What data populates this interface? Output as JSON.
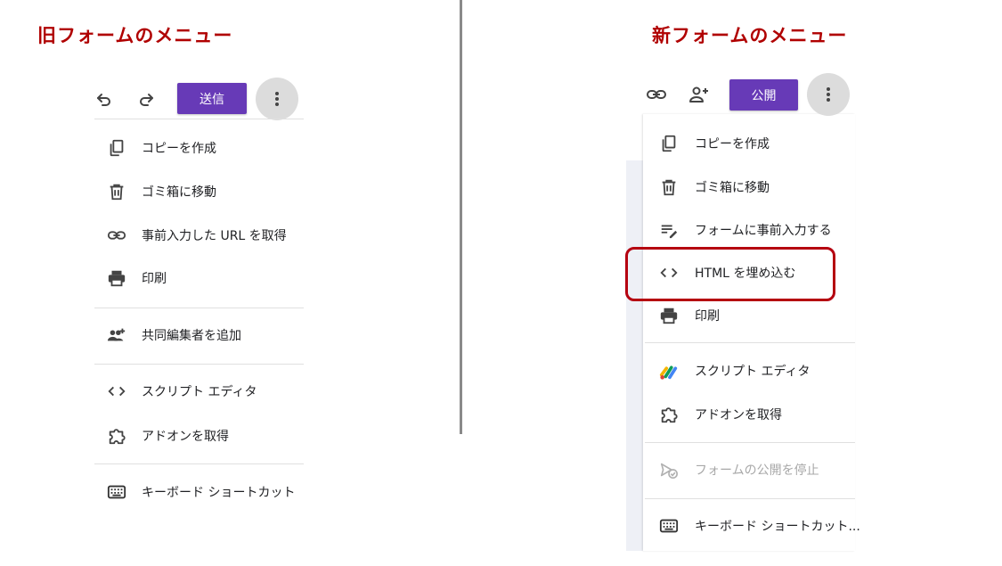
{
  "old_menu": {
    "heading": "旧フォームのメニュー",
    "toolbar": {
      "undo_icon": "undo-icon",
      "redo_icon": "redo-icon",
      "send_label": "送信",
      "more_icon": "more-vert-icon"
    },
    "items": [
      {
        "icon": "copy-icon",
        "label": "コピーを作成"
      },
      {
        "icon": "trash-icon",
        "label": "ゴミ箱に移動"
      },
      {
        "icon": "link-icon",
        "label": "事前入力した URL を取得"
      },
      {
        "icon": "print-icon",
        "label": "印刷"
      },
      {
        "icon": "collaborators-icon",
        "label": "共同編集者を追加"
      },
      {
        "icon": "code-icon",
        "label": "スクリプト エディタ"
      },
      {
        "icon": "puzzle-icon",
        "label": "アドオンを取得"
      },
      {
        "icon": "keyboard-icon",
        "label": "キーボード ショートカット"
      }
    ]
  },
  "new_menu": {
    "heading": "新フォームのメニュー",
    "toolbar": {
      "link_icon": "link-icon",
      "add_person_icon": "add-person-icon",
      "publish_label": "公開",
      "more_icon": "more-vert-icon"
    },
    "items": [
      {
        "icon": "copy-icon",
        "label": "コピーを作成"
      },
      {
        "icon": "trash-icon",
        "label": "ゴミ箱に移動"
      },
      {
        "icon": "prefill-icon",
        "label": "フォームに事前入力する"
      },
      {
        "icon": "code-icon",
        "label": "HTML を埋め込む"
      },
      {
        "icon": "print-icon",
        "label": "印刷"
      },
      {
        "icon": "apps-script-icon",
        "label": "スクリプト エディタ"
      },
      {
        "icon": "puzzle-icon",
        "label": "アドオンを取得"
      },
      {
        "icon": "unpublish-icon",
        "label": "フォームの公開を停止",
        "disabled": true
      },
      {
        "icon": "keyboard-icon",
        "label": "キーボード ショートカット..."
      }
    ]
  },
  "colors": {
    "heading": "#b00000",
    "primary_button": "#673ab7",
    "highlight": "#b50010"
  }
}
